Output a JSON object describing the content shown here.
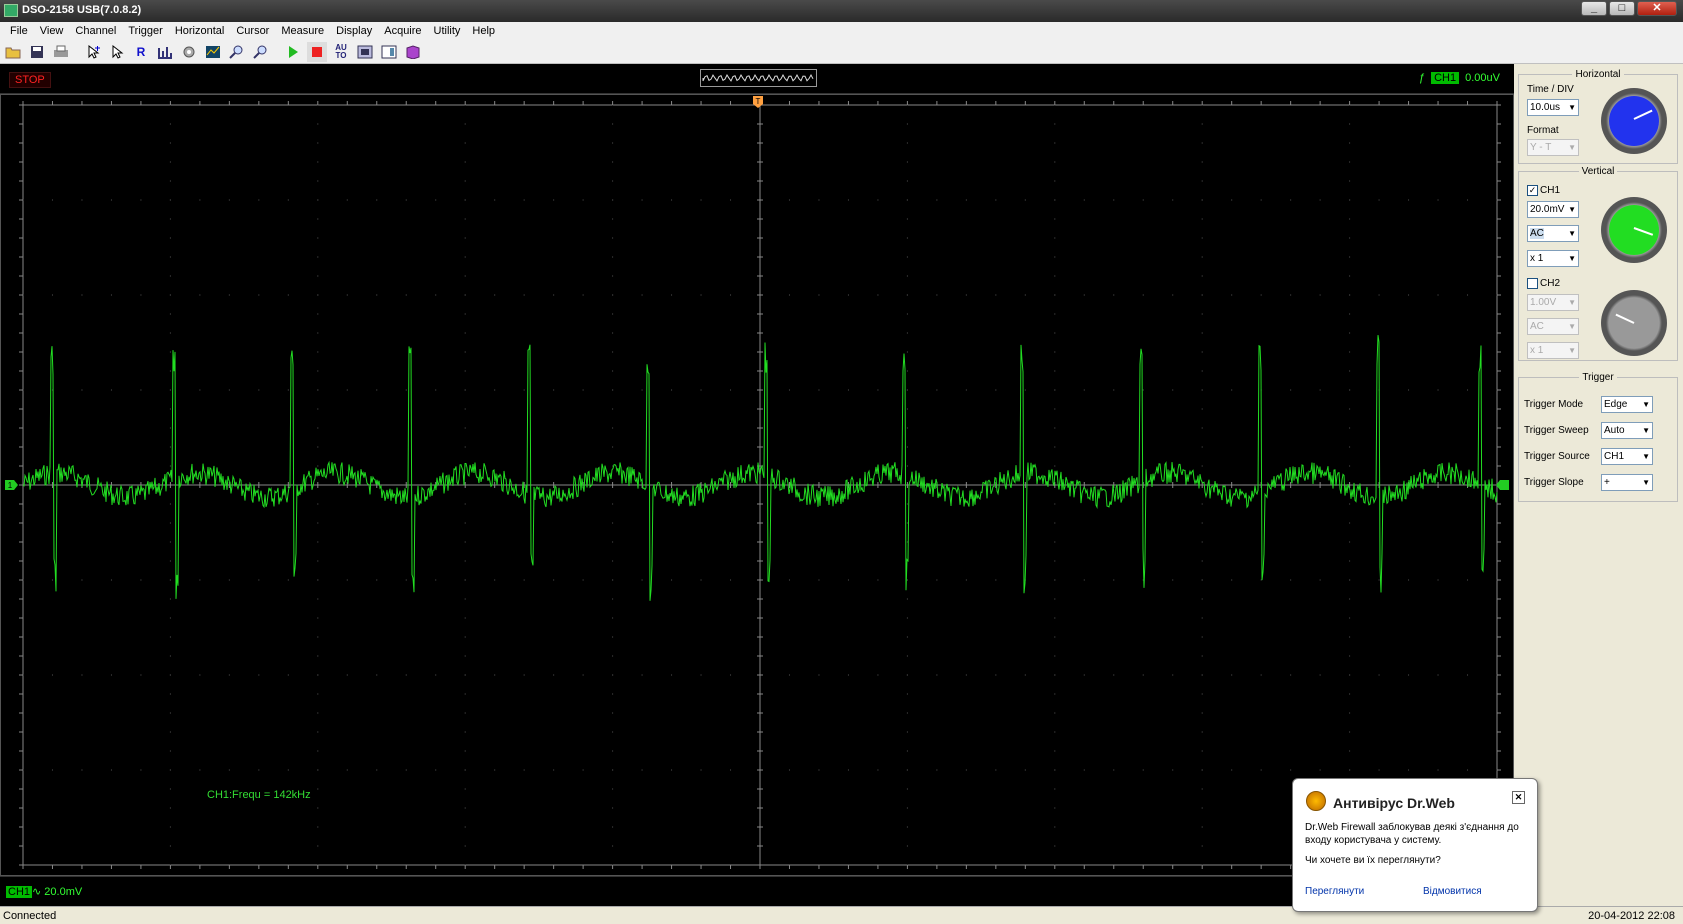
{
  "window": {
    "title": "DSO-2158 USB(7.0.8.2)",
    "buttons": [
      "_",
      "□",
      "✕"
    ]
  },
  "menu": [
    "File",
    "View",
    "Channel",
    "Trigger",
    "Horizontal",
    "Cursor",
    "Measure",
    "Display",
    "Acquire",
    "Utility",
    "Help"
  ],
  "toolbar": {
    "icons": [
      "open-icon",
      "save-icon",
      "print-icon",
      "cursor-cross-icon",
      "pointer-icon",
      "R",
      "fft-icon",
      "settings-icon",
      "display-icon",
      "zoom-in-icon",
      "zoom-out-icon",
      "run-icon",
      "stop-icon",
      "AUTO",
      "capture-icon",
      "window-icon",
      "help-book-icon"
    ],
    "r_label": "R",
    "auto_label": "AU\nTO"
  },
  "scope": {
    "run_state": "STOP",
    "trigger_marker": "T",
    "trigger_channel": "CH1",
    "trigger_level": "0.00uV",
    "measurement": "CH1:Frequ = 142kHz",
    "channel_badge": "CH1",
    "channel_coupling_icon": "∿",
    "channel_scale": "20.0mV",
    "ground_marker": "1",
    "trace_color": "#22dd22",
    "grid_color": "#555555"
  },
  "horizontal": {
    "group_title": "Horizontal",
    "time_div_label": "Time / DIV",
    "time_div_value": "10.0us",
    "format_label": "Format",
    "format_value": "Y - T",
    "knob_color": "#2233ee"
  },
  "vertical": {
    "group_title": "Vertical",
    "ch1_label": "CH1",
    "ch1_checked": true,
    "ch1_volts": "20.0mV",
    "ch1_coupling": "AC",
    "ch1_probe": "x 1",
    "ch1_knob_color": "#22dd22",
    "ch2_label": "CH2",
    "ch2_checked": false,
    "ch2_volts": "1.00V",
    "ch2_coupling": "AC",
    "ch2_probe": "x 1",
    "ch2_knob_color": "#999999"
  },
  "trigger": {
    "group_title": "Trigger",
    "mode_label": "Trigger Mode",
    "mode_value": "Edge",
    "sweep_label": "Trigger Sweep",
    "sweep_value": "Auto",
    "source_label": "Trigger Source",
    "source_value": "CH1",
    "slope_label": "Trigger Slope",
    "slope_value": "+"
  },
  "status": {
    "text": "Connected",
    "datetime": "20-04-2012  22:08"
  },
  "popup": {
    "title": "Антивірус Dr.Web",
    "message": "Dr.Web Firewall заблокував деякі з'єднання до входу користувача у систему.",
    "question": "Чи хочете ви їх переглянути?",
    "view_link": "Переглянути",
    "decline_link": "Відмовитися",
    "close": "✕"
  }
}
